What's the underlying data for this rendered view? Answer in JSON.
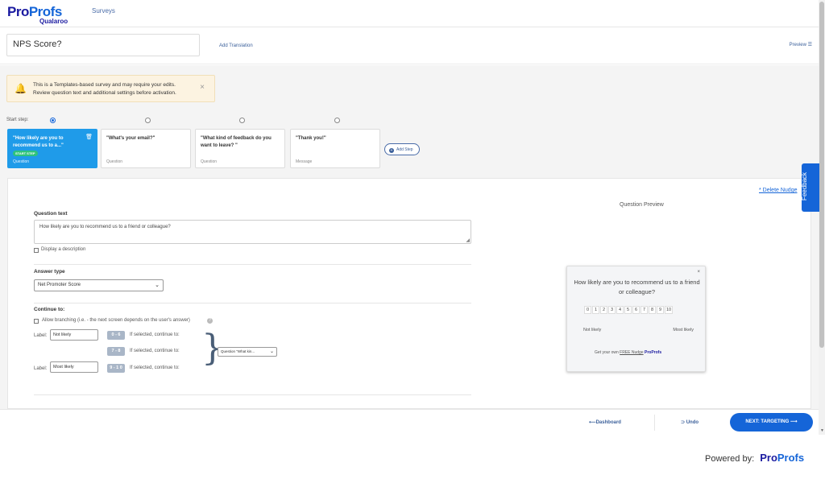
{
  "app": {
    "logo_pro": "Pro",
    "logo_profs": "Profs",
    "logo_sub": "Qualaroo",
    "nav_surveys": "Surveys"
  },
  "title_row": {
    "survey_title": "NPS Score?",
    "add_translation": "Add Translation",
    "preview": "Preview ☰"
  },
  "warning": {
    "line1": "This is a Templates-based survey and may require your edits.",
    "line2": "Review question text and additional settings before activation."
  },
  "steps": {
    "start_step_label": "Start step:",
    "cards": [
      {
        "title": "\"How likely are you to recommend us to a...\"",
        "type": "Question",
        "badge": "START STEP"
      },
      {
        "title": "\"What's your email?\"",
        "type": "Question"
      },
      {
        "title": "\"What kind of feedback do you want to leave? \"",
        "type": "Question"
      },
      {
        "title": "\"Thank you!\"",
        "type": "Message"
      }
    ],
    "add_step": "Add Step"
  },
  "editor": {
    "delete_nudge": "* Delete Nudge",
    "question_text_label": "Question text",
    "question_text_value": "How likely are you to recommend us to a friend or colleague?",
    "display_description": "Display a description",
    "answer_type_label": "Answer type",
    "answer_type_value": "Net Promoter Score",
    "continue_to_label": "Continue to:",
    "allow_branching": "Allow branching (i.e. - the next screen depends on the user's answer)",
    "label_text": "Label:",
    "label_low_value": "Not likely",
    "label_high_value": "Most likely",
    "ranges": [
      "0 - 6",
      "7 - 8",
      "9 - 1 0"
    ],
    "if_selected": "If selected, continue to:",
    "continue_select_value": "Question \"What kin...",
    "question_preview_title": "Question Preview"
  },
  "nudge": {
    "question": "How likely are you to recommend us to a friend or colleague?",
    "scale": [
      "0",
      "1",
      "2",
      "3",
      "4",
      "5",
      "6",
      "7",
      "8",
      "9",
      "10"
    ],
    "low": "Not likely",
    "high": "Most likely",
    "footer_prefix": "Get your own",
    "footer_free": "FREE Nudge",
    "footer_brand": "ProProfs",
    "close": "×"
  },
  "feedback_tab": "Feedback",
  "bottom": {
    "dashboard": "⟵Dashboard",
    "undo": "⊃ Undo",
    "next": "NEXT: TARGETING ⟶"
  },
  "powered": {
    "label": "Powered by:",
    "brand_pro": "Pro",
    "brand_profs": "Profs"
  }
}
